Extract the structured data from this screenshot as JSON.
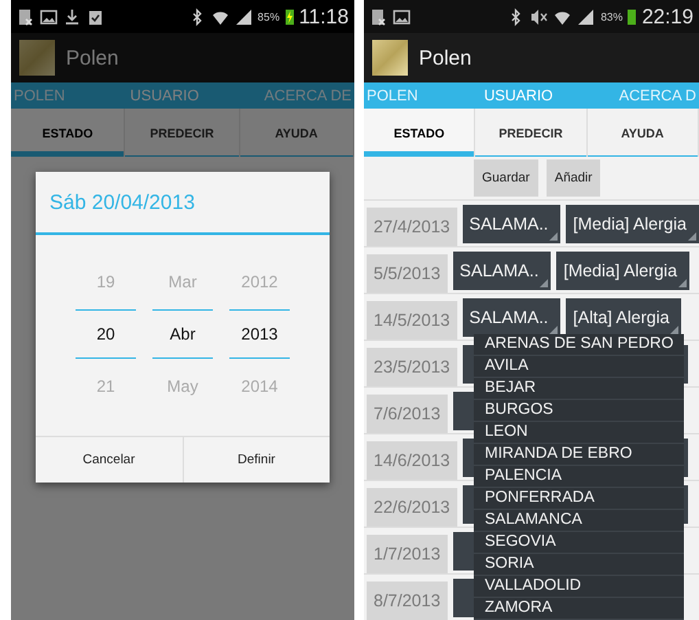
{
  "phones": [
    {
      "status_bar": {
        "download_notification": true,
        "task_notification": true,
        "muted": false,
        "battery": "85%",
        "charging": true,
        "time": "11:18"
      },
      "app_title": "Polen",
      "nav_tabs": [
        {
          "label": "POLEN",
          "selected": false
        },
        {
          "label": "USUARIO",
          "selected": true
        },
        {
          "label": "ACERCA DE",
          "selected": false
        }
      ],
      "sub_tabs": [
        {
          "label": "ESTADO",
          "selected": true
        },
        {
          "label": "PREDECIR",
          "selected": false
        },
        {
          "label": "AYUDA",
          "selected": false
        }
      ],
      "dialog": {
        "title": "Sáb 20/04/2013",
        "columns": [
          {
            "items": [
              {
                "label": "19",
                "selected": false
              },
              {
                "label": "20",
                "selected": true
              },
              {
                "label": "21",
                "selected": false
              }
            ]
          },
          {
            "items": [
              {
                "label": "Mar",
                "selected": false
              },
              {
                "label": "Abr",
                "selected": true
              },
              {
                "label": "May",
                "selected": false
              }
            ]
          },
          {
            "items": [
              {
                "label": "2012",
                "selected": false
              },
              {
                "label": "2013",
                "selected": true
              },
              {
                "label": "2014",
                "selected": false
              }
            ]
          }
        ],
        "buttons": [
          "Cancelar",
          "Definir"
        ]
      }
    },
    {
      "status_bar": {
        "download_notification": false,
        "task_notification": false,
        "muted": true,
        "battery": "83%",
        "charging": false,
        "time": "22:19"
      },
      "app_title": "Polen",
      "nav_tabs": [
        {
          "label": "POLEN",
          "selected": false
        },
        {
          "label": "USUARIO",
          "selected": true
        },
        {
          "label": "ACERCA D",
          "selected": false
        }
      ],
      "sub_tabs": [
        {
          "label": "ESTADO",
          "selected": true
        },
        {
          "label": "PREDECIR",
          "selected": false
        },
        {
          "label": "AYUDA",
          "selected": false
        }
      ],
      "content": {
        "actions": [
          "Guardar",
          "Añadir"
        ],
        "rows": [
          {
            "date": "27/4/2013",
            "city": "SALAMA..",
            "allergy": "[Media] Alergia"
          },
          {
            "date": "5/5/2013",
            "city": "SALAMA..",
            "allergy": "[Media] Alergia"
          },
          {
            "date": "14/5/2013",
            "city": "SALAMA..",
            "allergy": "[Alta] Alergia",
            "city_options": [
              "ARENAS DE SAN PEDRO",
              "AVILA",
              "BEJAR",
              "BURGOS",
              "LEON",
              "MIRANDA DE EBRO",
              "PALENCIA",
              "PONFERRADA",
              "SALAMANCA",
              "SEGOVIA",
              "SORIA",
              "VALLADOLID",
              "ZAMORA"
            ]
          },
          {
            "date": "23/5/2013"
          },
          {
            "date": "7/6/2013"
          },
          {
            "date": "14/6/2013"
          },
          {
            "date": "22/6/2013"
          },
          {
            "date": "1/7/2013"
          },
          {
            "date": "8/7/2013"
          }
        ]
      }
    }
  ]
}
